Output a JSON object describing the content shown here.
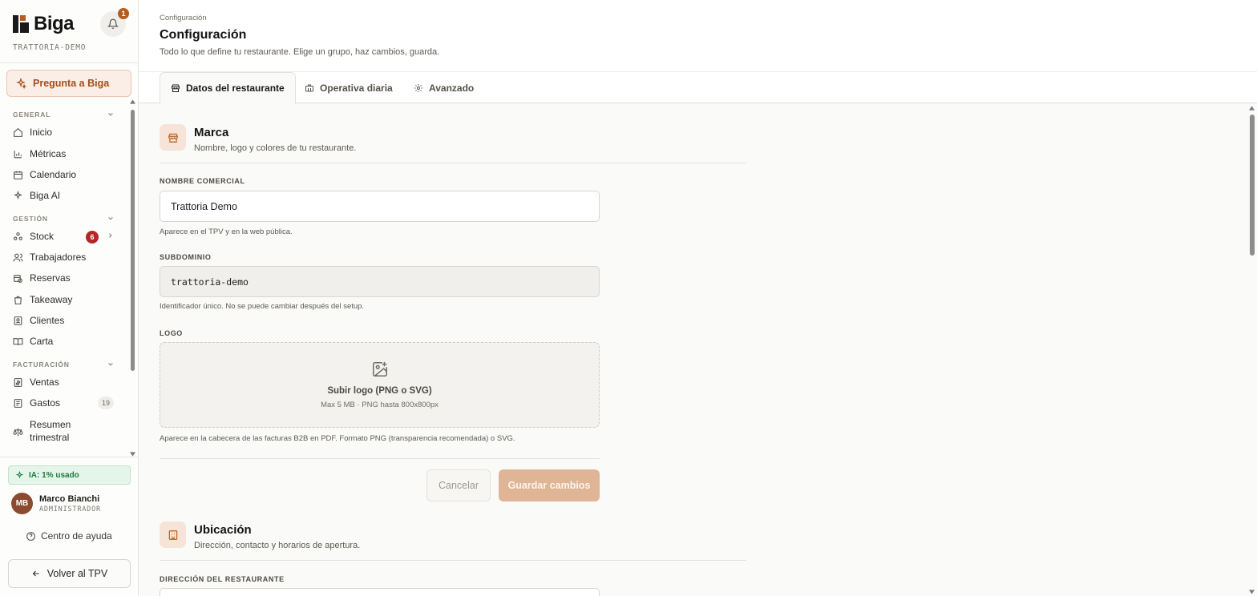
{
  "brand": {
    "name": "Biga",
    "tenant": "TRATTORIA-DEMO"
  },
  "notifications": {
    "count": "1"
  },
  "ask_button": "Pregunta a Biga",
  "nav": {
    "general_label": "GENERAL",
    "general": [
      "Inicio",
      "Métricas",
      "Calendario",
      "Biga AI"
    ],
    "gestion_label": "GESTIÓN",
    "gestion": [
      "Stock",
      "Trabajadores",
      "Reservas",
      "Takeaway",
      "Clientes",
      "Carta"
    ],
    "stock_badge": "6",
    "facturacion_label": "FACTURACIÓN",
    "facturacion": [
      "Ventas",
      "Gastos",
      "Resumen",
      "trimestral"
    ],
    "gastos_count": "19"
  },
  "ai_usage": "IA: 1% usado",
  "user": {
    "initials": "MB",
    "name": "Marco Bianchi",
    "role": "ADMINISTRADOR"
  },
  "help": "Centro de ayuda",
  "back_button": "Volver al TPV",
  "header": {
    "breadcrumb": "Configuración",
    "title": "Configuración",
    "subtitle": "Todo lo que define tu restaurante. Elige un grupo, haz cambios, guarda."
  },
  "tabs": [
    "Datos del restaurante",
    "Operativa diaria",
    "Avanzado"
  ],
  "marca": {
    "title": "Marca",
    "subtitle": "Nombre, logo y colores de tu restaurante.",
    "name_label": "NOMBRE COMERCIAL",
    "name_value": "Trattoria Demo",
    "name_hint": "Aparece en el TPV y en la web pública.",
    "subdomain_label": "SUBDOMINIO",
    "subdomain_value": "trattoria-demo",
    "subdomain_hint": "Identificador único. No se puede cambiar después del setup.",
    "logo_label": "LOGO",
    "logo_upload": "Subir logo (PNG o SVG)",
    "logo_limits": "Max 5 MB · PNG hasta 800x800px",
    "logo_hint": "Aparece en la cabecera de las facturas B2B en PDF. Formato PNG (transparencia recomendada) o SVG.",
    "cancel": "Cancelar",
    "save": "Guardar cambios"
  },
  "ubicacion": {
    "title": "Ubicación",
    "subtitle": "Dirección, contacto y horarios de apertura.",
    "address_label": "DIRECCIÓN DEL RESTAURANTE"
  },
  "colors": {
    "accent": "#b35e1f",
    "accent_soft": "#f6e4d8",
    "danger": "#b52727",
    "success": "#1f7a3d"
  }
}
